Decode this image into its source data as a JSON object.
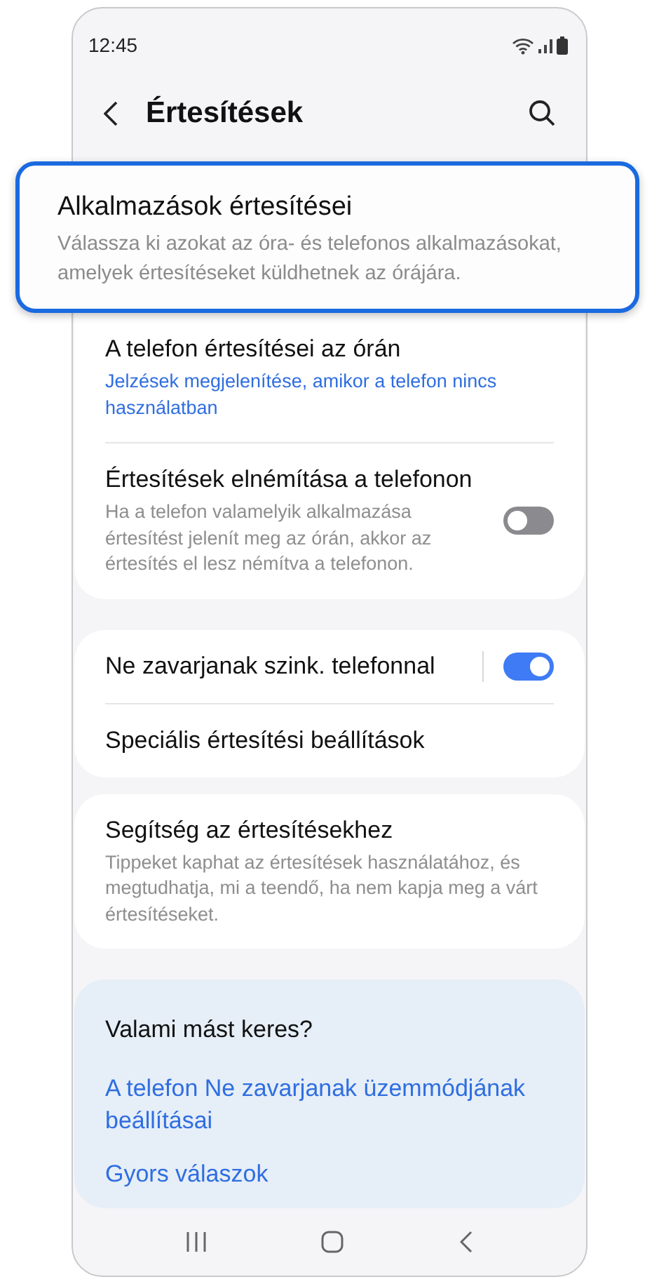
{
  "status_bar": {
    "time": "12:45"
  },
  "header": {
    "title": "Értesítések"
  },
  "callout": {
    "title": "Alkalmazások értesítései",
    "description": "Válassza ki azokat az óra- és telefonos alkalmazásokat, amelyek értesítéseket küldhetnek az órájára."
  },
  "groups": [
    {
      "items": [
        {
          "kind": "link",
          "title": "A telefon értesítései az órán",
          "subtitle": "Jelzések megjelenítése, amikor a telefon nincs használatban"
        },
        {
          "kind": "toggle",
          "title": "Értesítések elnémítása a telefonon",
          "subtitle": "Ha a telefon valamelyik alkalmazása értesítést jelenít meg az órán, akkor az értesítés el lesz némítva a telefonon.",
          "on": false
        }
      ]
    },
    {
      "items": [
        {
          "kind": "toggle",
          "title": "Ne zavarjanak szink. telefonnal",
          "on": true
        },
        {
          "kind": "plain",
          "title": "Speciális értesítési beállítások"
        }
      ]
    },
    {
      "items": [
        {
          "kind": "plain",
          "title": "Segítség az értesítésekhez",
          "subtitle": "Tippeket kaphat az értesítések használatához, és megtudhatja, mi a teendő, ha nem kapja meg a várt értesítéseket."
        }
      ]
    }
  ],
  "suggestions": {
    "title": "Valami mást keres?",
    "links": [
      "A telefon Ne zavarjanak üzemmódjának beállításai",
      "Gyors válaszok"
    ]
  }
}
